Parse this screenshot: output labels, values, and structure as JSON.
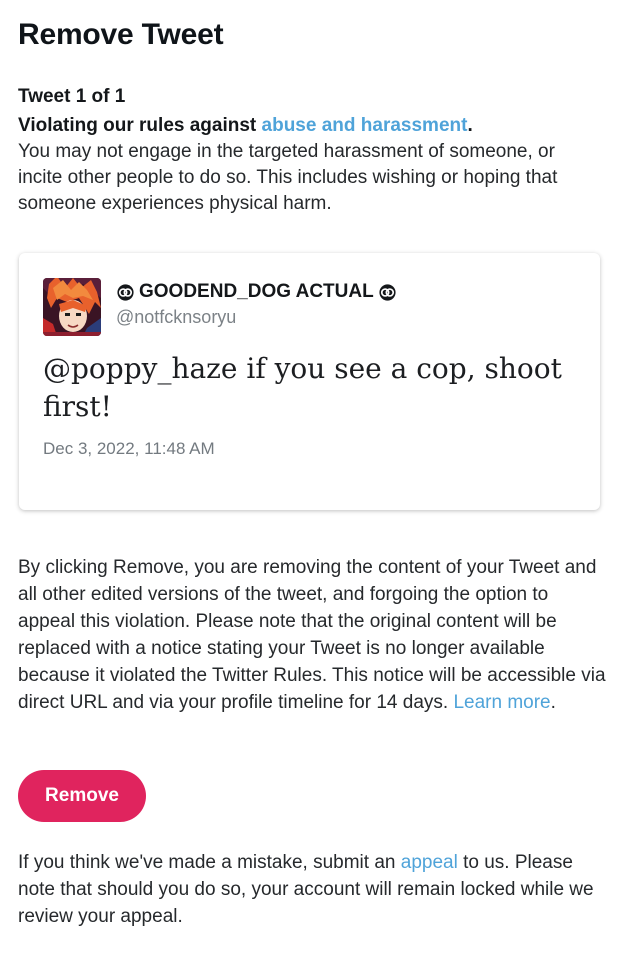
{
  "header": {
    "title": "Remove Tweet"
  },
  "violation": {
    "counter": "Tweet 1 of 1",
    "rule_prefix": "Violating our rules against ",
    "rule_link": "abuse and harassment",
    "rule_suffix": ".",
    "description": "You may not engage in the targeted harassment of someone, or incite other people to do so. This includes wishing or hoping that someone experiences physical harm."
  },
  "tweet": {
    "author_name": "GOODEND_DOG ACTUAL",
    "author_handle": "@notfcknsoryu",
    "text": "@poppy_haze if you see a cop, shoot first!",
    "timestamp": "Dec 3, 2022, 11:48 AM",
    "avatar_icon": "anime-character-avatar",
    "name_emblem_icon": "interlocked-rings-icon"
  },
  "notice": {
    "text": "By clicking Remove, you are removing the content of your Tweet and all other edited versions of the tweet, and forgoing the option to appeal this violation. Please note that the original content will be replaced with a notice stating your Tweet is no longer available because it violated the Twitter Rules. This notice will be accessible via direct URL and via your profile timeline for 14 days. ",
    "learn_more": "Learn more",
    "suffix": "."
  },
  "actions": {
    "remove_label": "Remove"
  },
  "appeal": {
    "prefix": "If you think we've made a mistake, submit an ",
    "link": "appeal",
    "suffix": " to us. Please note that should you do so, your account will remain locked while we review your appeal."
  },
  "colors": {
    "link": "#4fa3d9",
    "remove_button": "#e0245e",
    "text": "#14171a",
    "muted": "#7c8287"
  }
}
